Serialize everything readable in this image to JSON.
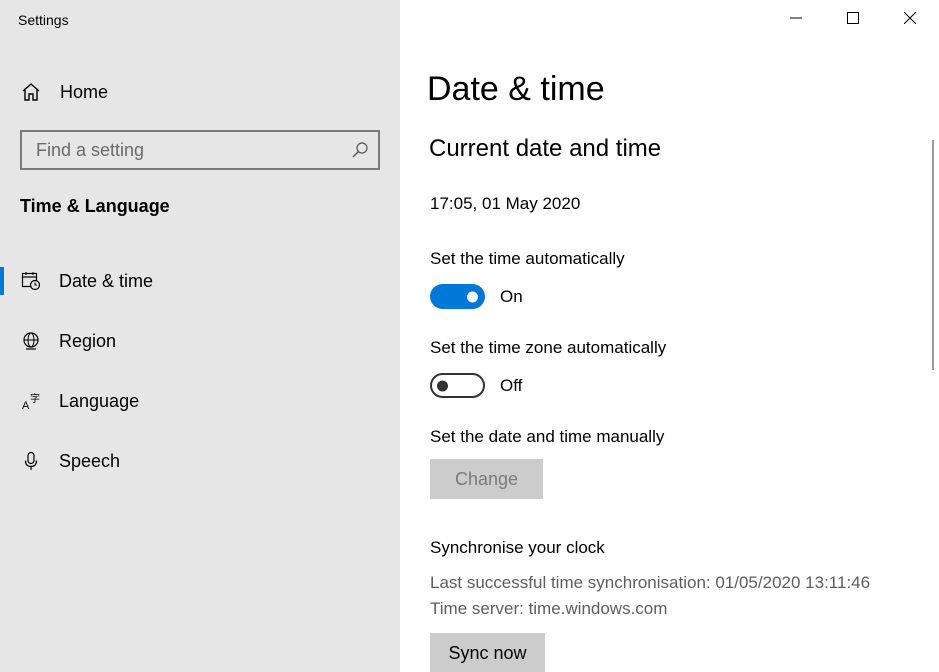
{
  "window": {
    "app_title": "Settings",
    "controls": {
      "minimize_icon": "minimize-icon",
      "maximize_icon": "maximize-icon",
      "close_icon": "close-icon"
    }
  },
  "sidebar": {
    "home_label": "Home",
    "home_icon": "home-icon",
    "search": {
      "placeholder": "Find a setting",
      "value": "",
      "icon": "search-icon"
    },
    "section_title": "Time & Language",
    "items": [
      {
        "label": "Date & time",
        "icon": "calendar-clock-icon",
        "selected": true
      },
      {
        "label": "Region",
        "icon": "globe-icon",
        "selected": false
      },
      {
        "label": "Language",
        "icon": "language-icon",
        "selected": false
      },
      {
        "label": "Speech",
        "icon": "microphone-icon",
        "selected": false
      }
    ],
    "accent_color": "#0078d7"
  },
  "main": {
    "page_title": "Date & time",
    "section_title": "Current date and time",
    "current_datetime": "17:05, 01 May 2020",
    "auto_time": {
      "label": "Set the time automatically",
      "state": "On",
      "enabled": true
    },
    "auto_timezone": {
      "label": "Set the time zone automatically",
      "state": "Off",
      "enabled": false
    },
    "manual": {
      "label": "Set the date and time manually",
      "button_label": "Change",
      "button_disabled": true
    },
    "sync": {
      "title": "Synchronise your clock",
      "last_sync": "Last successful time synchronisation: 01/05/2020 13:11:46",
      "server": "Time server: time.windows.com",
      "button_label": "Sync now"
    }
  }
}
